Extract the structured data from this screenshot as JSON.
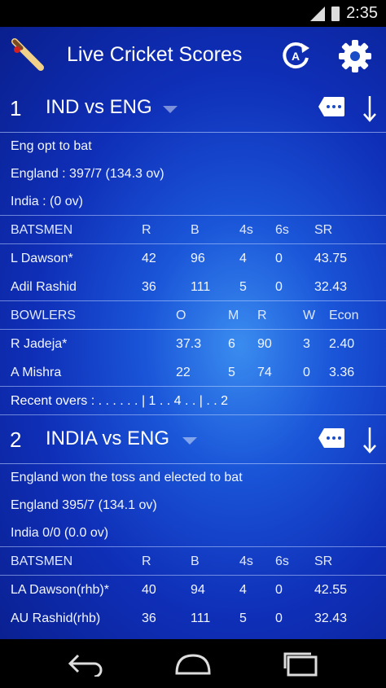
{
  "status_bar": {
    "time": "2:35"
  },
  "toolbar": {
    "title": "Live Cricket Scores"
  },
  "matches": [
    {
      "number": "1",
      "name": "IND vs ENG",
      "info": [
        "Eng opt to bat",
        "England : 397/7 (134.3 ov)",
        "India : (0 ov)"
      ],
      "batting_headers": [
        "BATSMEN",
        "R",
        "B",
        "4s",
        "6s",
        "SR"
      ],
      "batsmen": [
        [
          "L Dawson*",
          "42",
          "96",
          "4",
          "0",
          "43.75"
        ],
        [
          "Adil Rashid",
          "36",
          "111",
          "5",
          "0",
          "32.43"
        ]
      ],
      "bowling_headers": [
        "BOWLERS",
        "O",
        "M",
        "R",
        "W",
        "Econ"
      ],
      "bowlers": [
        [
          "R Jadeja*",
          "37.3",
          "6",
          "90",
          "3",
          "2.40"
        ],
        [
          "A Mishra",
          "22",
          "5",
          "74",
          "0",
          "3.36"
        ]
      ],
      "recent_overs": "Recent overs : . . . . . . | 1 . . 4 . . | . . 2"
    },
    {
      "number": "2",
      "name": "INDIA vs ENG",
      "info": [
        "England won the toss and elected to bat",
        "England 395/7 (134.1 ov)",
        "India 0/0 (0.0 ov)"
      ],
      "batting_headers": [
        "BATSMEN",
        "R",
        "B",
        "4s",
        "6s",
        "SR"
      ],
      "batsmen": [
        [
          "LA Dawson(rhb)*",
          "40",
          "94",
          "4",
          "0",
          "42.55"
        ],
        [
          "AU Rashid(rhb)",
          "36",
          "111",
          "5",
          "0",
          "32.43"
        ]
      ]
    }
  ],
  "icons": {
    "app_logo": "cricket-bat-icon",
    "refresh": "refresh-icon",
    "settings": "gear-icon",
    "commentary": "comment-icon",
    "expand": "arrow-down-icon"
  },
  "colors": {
    "background": "#1a55d8",
    "accent": "#ffffff"
  }
}
